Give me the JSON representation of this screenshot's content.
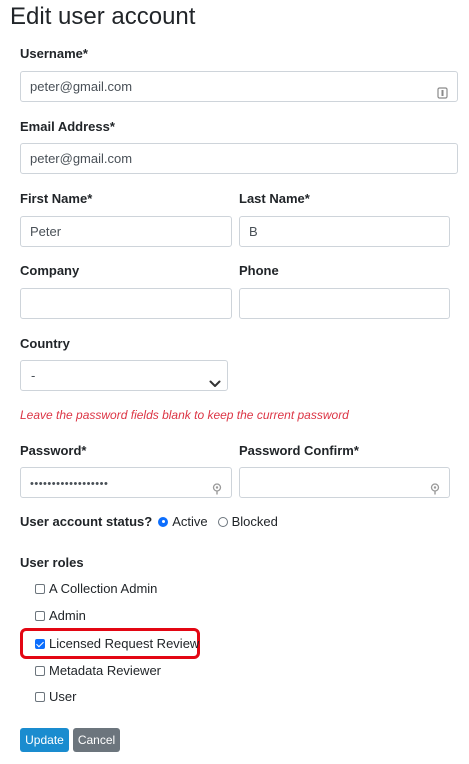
{
  "page": {
    "title": "Edit user account"
  },
  "form": {
    "username": {
      "label": "Username*",
      "value": "peter@gmail.com"
    },
    "email": {
      "label": "Email Address*",
      "value": "peter@gmail.com"
    },
    "first_name": {
      "label": "First Name*",
      "value": "Peter"
    },
    "last_name": {
      "label": "Last Name*",
      "value": "B"
    },
    "company": {
      "label": "Company",
      "value": ""
    },
    "phone": {
      "label": "Phone",
      "value": ""
    },
    "country": {
      "label": "Country",
      "selected": "-"
    },
    "password_hint": "Leave the password fields blank to keep the current password",
    "password": {
      "label": "Password*",
      "value": "••••••••••••••••••"
    },
    "password_confirm": {
      "label": "Password Confirm*",
      "value": ""
    },
    "status": {
      "label": "User account status?",
      "options": [
        {
          "label": "Active",
          "checked": true
        },
        {
          "label": "Blocked",
          "checked": false
        }
      ]
    },
    "roles": {
      "label": "User roles",
      "items": [
        {
          "label": "A Collection Admin",
          "checked": false
        },
        {
          "label": "Admin",
          "checked": false
        },
        {
          "label": "Licensed Request Review",
          "checked": true
        },
        {
          "label": "Metadata Reviewer",
          "checked": false
        },
        {
          "label": "User",
          "checked": false
        }
      ]
    }
  },
  "buttons": {
    "update": "Update",
    "cancel": "Cancel"
  },
  "colors": {
    "primary": "#1a8ccf",
    "secondary": "#6c757d",
    "hint": "#dc3545",
    "highlight": "#e30613"
  }
}
